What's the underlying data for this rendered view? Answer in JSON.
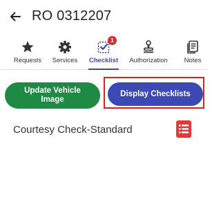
{
  "header": {
    "title": "RO 0312207"
  },
  "tabs": [
    {
      "label": "Requests",
      "icon": "star-icon"
    },
    {
      "label": "Services",
      "icon": "gear-icon"
    },
    {
      "label": "Checklist",
      "icon": "checklist-icon",
      "badge": "1",
      "active": true
    },
    {
      "label": "Authorization",
      "icon": "stamp-icon"
    },
    {
      "label": "Notes",
      "icon": "notes-icon"
    }
  ],
  "actions": {
    "update_vehicle_image": "Update Vehicle Image",
    "display_checklists": "Display Checklists"
  },
  "checklists": [
    {
      "name": "Courtesy Check-Standard",
      "icon": "list-icon"
    }
  ],
  "colors": {
    "accent": "#3c48b4",
    "green_button": "#1e8a43",
    "highlight": "#e02020",
    "badge": "#d32f2f",
    "list_icon": "#e53935"
  }
}
